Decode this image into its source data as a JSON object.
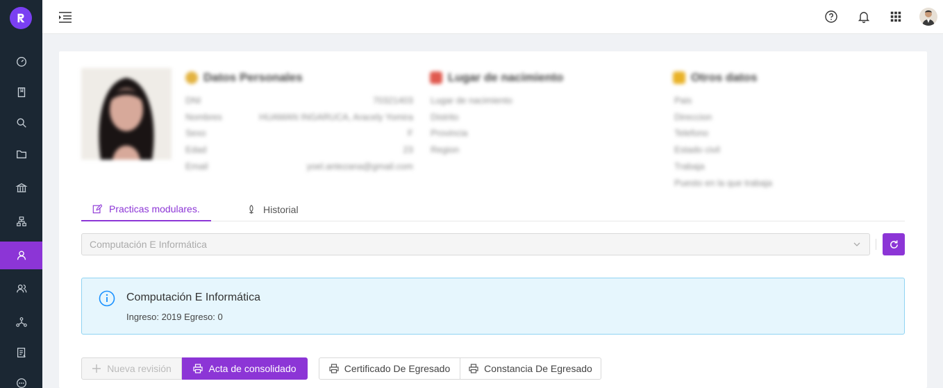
{
  "sidebar": {
    "items": [
      {
        "icon": "dashboard-icon"
      },
      {
        "icon": "book-icon"
      },
      {
        "icon": "search-icon"
      },
      {
        "icon": "folder-icon"
      },
      {
        "icon": "institution-icon"
      },
      {
        "icon": "org-chart-icon"
      },
      {
        "icon": "user-icon",
        "active": true
      },
      {
        "icon": "users-icon"
      },
      {
        "icon": "network-icon"
      },
      {
        "icon": "report-icon"
      },
      {
        "icon": "more-icon"
      }
    ]
  },
  "topbar": {
    "icons": [
      "help-icon",
      "bell-icon",
      "apps-grid-icon",
      "user-avatar"
    ]
  },
  "profile": {
    "personal": {
      "title": "Datos Personales",
      "fields": [
        {
          "label": "DNI",
          "value": "70321403"
        },
        {
          "label": "Nombres",
          "value": "HUAMAN INGARUCA, Aracely Yomira"
        },
        {
          "label": "Sexo",
          "value": "F"
        },
        {
          "label": "Edad",
          "value": "23"
        },
        {
          "label": "Email",
          "value": "yoel.antezana@gmail.com"
        }
      ]
    },
    "birthplace": {
      "title": "Lugar de nacimiento",
      "fields": [
        "Lugar de nacimiento",
        "Distrito",
        "Provincia",
        "Region"
      ]
    },
    "other": {
      "title": "Otros datos",
      "fields": [
        "Pais",
        "Direccion",
        "Telefono",
        "Estado civil",
        "Trabaja",
        "Puesto en la que trabaja"
      ]
    }
  },
  "tabs": [
    {
      "label": "Practicas modulares.",
      "active": true
    },
    {
      "label": "Historial",
      "active": false
    }
  ],
  "program_select": {
    "value": "Computación E Informática"
  },
  "alert": {
    "title": "Computación E Informática",
    "description": "Ingreso: 2019 Egreso: 0"
  },
  "actions": {
    "new_review": "Nueva revisión",
    "consolidated": "Acta de consolidado",
    "certificate": "Certificado De Egresado",
    "constancy": "Constancia De Egresado"
  },
  "colors": {
    "accent": "#8c35d6",
    "sidebar": "#1b2733",
    "info_bg": "#e6f6fd",
    "info_border": "#8fd3f2"
  }
}
